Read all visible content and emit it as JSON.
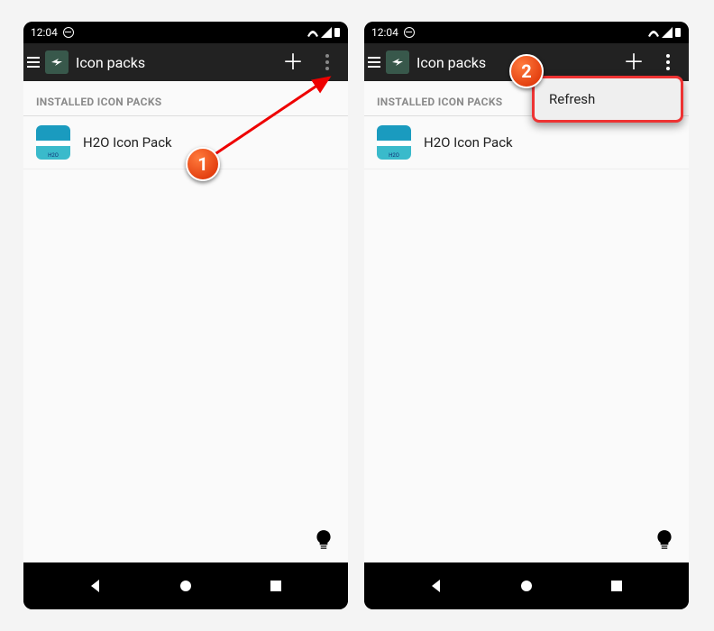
{
  "statusbar": {
    "time": "12:04"
  },
  "appbar": {
    "title": "Icon packs"
  },
  "section": {
    "header": "INSTALLED ICON PACKS"
  },
  "packs": [
    {
      "name": "H2O Icon Pack",
      "icon_label": "H2O"
    }
  ],
  "menu": {
    "refresh": "Refresh"
  },
  "annotations": {
    "step1": "1",
    "step2": "2"
  }
}
